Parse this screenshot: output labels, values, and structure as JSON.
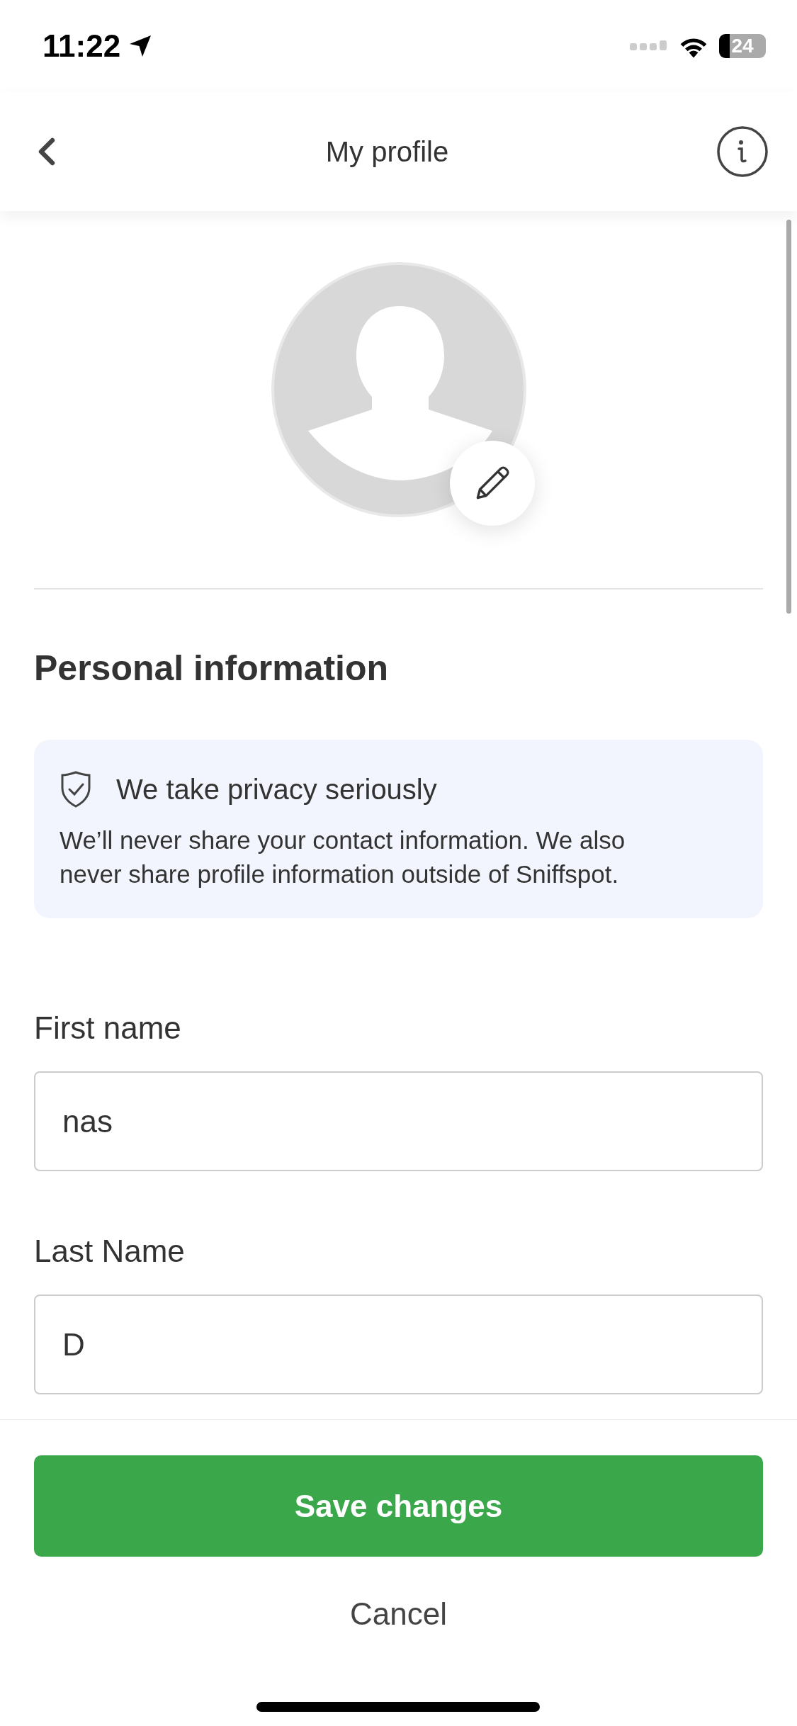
{
  "status_bar": {
    "time": "11:22",
    "battery": "24"
  },
  "header": {
    "title": "My profile"
  },
  "section_title": "Personal information",
  "privacy_card": {
    "title": "We take privacy seriously",
    "body": "We’ll never share your contact information. We also never share profile information outside of Sniffspot."
  },
  "fields": [
    {
      "label": "First name",
      "value": "nas"
    },
    {
      "label": "Last Name",
      "value": "D"
    }
  ],
  "footer": {
    "primary_button": "Save changes",
    "secondary_button": "Cancel"
  }
}
